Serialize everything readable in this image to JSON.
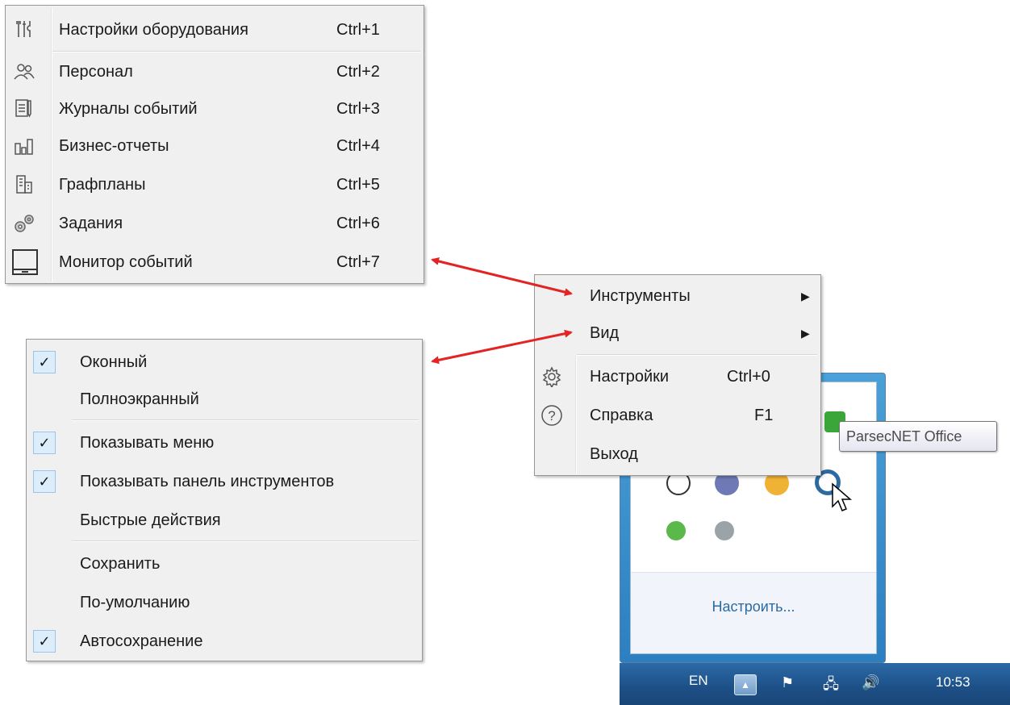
{
  "tools_menu": {
    "items": [
      {
        "label": "Настройки оборудования",
        "shortcut": "Ctrl+1",
        "icon": "hardware-settings-icon"
      },
      {
        "label": "Персонал",
        "shortcut": "Ctrl+2",
        "icon": "personnel-icon"
      },
      {
        "label": "Журналы событий",
        "shortcut": "Ctrl+3",
        "icon": "event-log-icon"
      },
      {
        "label": "Бизнес-отчеты",
        "shortcut": "Ctrl+4",
        "icon": "reports-icon"
      },
      {
        "label": "Графпланы",
        "shortcut": "Ctrl+5",
        "icon": "floor-plans-icon"
      },
      {
        "label": "Задания",
        "shortcut": "Ctrl+6",
        "icon": "tasks-icon"
      },
      {
        "label": "Монитор событий",
        "shortcut": "Ctrl+7",
        "icon": "event-monitor-icon"
      }
    ]
  },
  "view_menu": {
    "items": [
      {
        "label": "Оконный",
        "checked": true
      },
      {
        "label": "Полноэкранный",
        "checked": false
      },
      {
        "label": "Показывать меню",
        "checked": true
      },
      {
        "label": "Показывать панель инструментов",
        "checked": true
      },
      {
        "label": "Быстрые действия",
        "checked": false
      },
      {
        "label": "Сохранить",
        "checked": false
      },
      {
        "label": "По-умолчанию",
        "checked": false
      },
      {
        "label": "Автосохранение",
        "checked": true
      }
    ],
    "check_glyph": "✓"
  },
  "context_menu": {
    "items": [
      {
        "label": "Инструменты",
        "shortcut": "",
        "submenu": true
      },
      {
        "label": "Вид",
        "shortcut": "",
        "submenu": true
      },
      {
        "label": "Настройки",
        "shortcut": "Ctrl+0",
        "icon": "gear-icon"
      },
      {
        "label": "Справка",
        "shortcut": "F1",
        "icon": "help-icon"
      },
      {
        "label": "Выход",
        "shortcut": ""
      }
    ],
    "submenu_arrow": "▶"
  },
  "tray_popup": {
    "customize_label": "Настроить..."
  },
  "tooltip": {
    "text": "ParsecNET Office"
  },
  "taskbar": {
    "language": "EN",
    "clock": "10:53"
  },
  "colors": {
    "arrow": "#e32424",
    "menu_bg": "#f0f0f0",
    "taskbar": "#1d4f86"
  }
}
